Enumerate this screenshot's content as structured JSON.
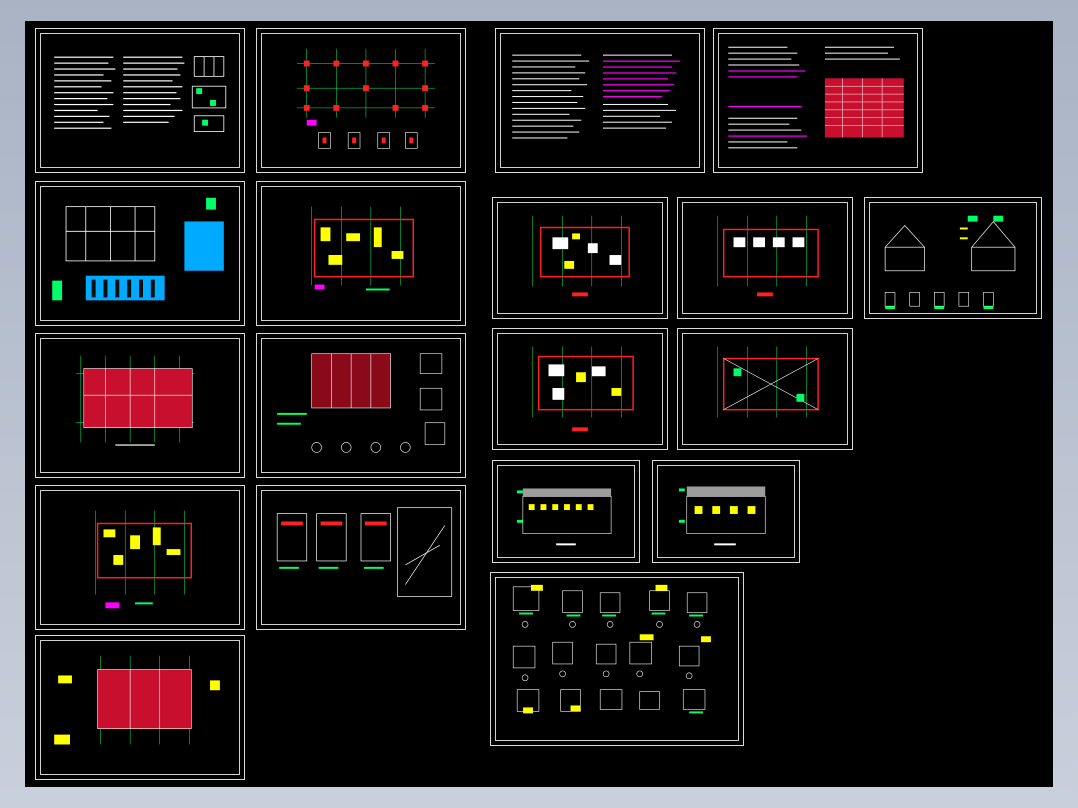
{
  "app": {
    "title": ""
  },
  "colors": {
    "background": "#000000",
    "frame": "#d9d9d9",
    "grid": "#00ff66",
    "wall": "#ff2020",
    "note": "#ff00ff",
    "fill_yellow": "#ffff00",
    "text": "#ffffff"
  },
  "sheets": [
    {
      "id": "s1",
      "kind": "notes"
    },
    {
      "id": "s2",
      "kind": "column-plan"
    },
    {
      "id": "s3",
      "kind": "foundation"
    },
    {
      "id": "s4",
      "kind": "floor-plan"
    },
    {
      "id": "s5",
      "kind": "red-plan"
    },
    {
      "id": "s6",
      "kind": "beam-plan"
    },
    {
      "id": "s7",
      "kind": "floor-plan"
    },
    {
      "id": "s8",
      "kind": "stair-detail"
    },
    {
      "id": "s9",
      "kind": "red-plan"
    },
    {
      "id": "s10",
      "kind": "notes-magenta"
    },
    {
      "id": "s11",
      "kind": "notes-table"
    },
    {
      "id": "s12",
      "kind": "arch-plan"
    },
    {
      "id": "s13",
      "kind": "arch-plan"
    },
    {
      "id": "s14",
      "kind": "section"
    },
    {
      "id": "s15",
      "kind": "arch-plan"
    },
    {
      "id": "s16",
      "kind": "arch-plan"
    },
    {
      "id": "s17",
      "kind": "elevation"
    },
    {
      "id": "s18",
      "kind": "elevation"
    },
    {
      "id": "s19",
      "kind": "details"
    }
  ]
}
